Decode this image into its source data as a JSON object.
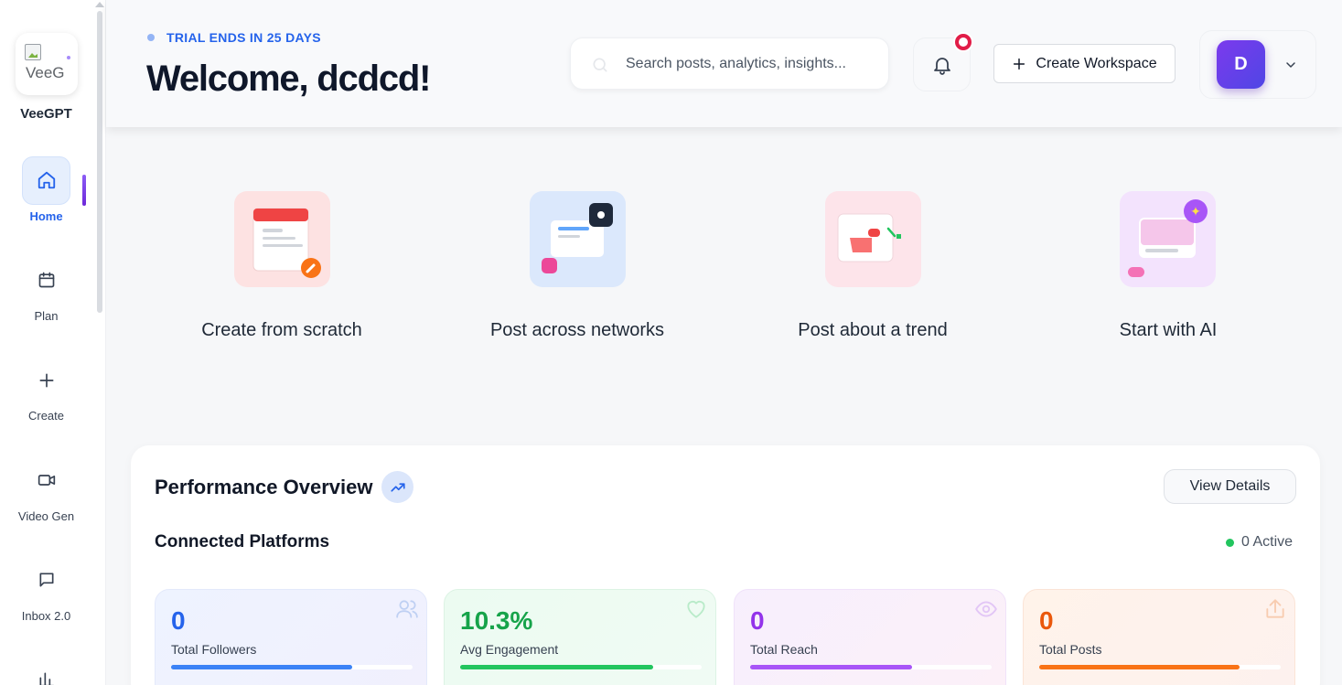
{
  "sidebar": {
    "logo_alt": "VeeG",
    "brand": "VeeGPT",
    "items": [
      {
        "label": "Home",
        "icon": "home-icon",
        "active": true
      },
      {
        "label": "Plan",
        "icon": "calendar-icon"
      },
      {
        "label": "Create",
        "icon": "plus-icon"
      },
      {
        "label": "Video Gen",
        "icon": "video-icon"
      },
      {
        "label": "Inbox 2.0",
        "icon": "chat-icon"
      },
      {
        "label": "",
        "icon": "analytics-icon"
      }
    ]
  },
  "header": {
    "trial": "TRIAL ENDS IN 25 DAYS",
    "welcome": "Welcome, dcdcd!",
    "search_placeholder": "Search posts, analytics, insights...",
    "create_workspace": "Create Workspace",
    "avatar_initial": "D"
  },
  "quick_actions": [
    {
      "label": "Create from scratch",
      "icon": "create-from-scratch-icon"
    },
    {
      "label": "Post across networks",
      "icon": "post-across-networks-icon"
    },
    {
      "label": "Post about a trend",
      "icon": "post-about-trend-icon"
    },
    {
      "label": "Start with AI",
      "icon": "start-with-ai-icon"
    }
  ],
  "performance": {
    "title": "Performance Overview",
    "view_details": "View Details",
    "connected_platforms": "Connected Platforms",
    "active_count": "0 Active",
    "stats": [
      {
        "value": "0",
        "label": "Total Followers",
        "color": "#2563eb",
        "progress": 0.75,
        "icon": "users-icon"
      },
      {
        "value": "10.3%",
        "label": "Avg Engagement",
        "color": "#16a34a",
        "progress": 0.8,
        "icon": "heart-icon"
      },
      {
        "value": "0",
        "label": "Total Reach",
        "color": "#9333ea",
        "progress": 0.67,
        "icon": "eye-icon"
      },
      {
        "value": "0",
        "label": "Total Posts",
        "color": "#ea580c",
        "progress": 0.83,
        "icon": "share-icon"
      }
    ]
  }
}
